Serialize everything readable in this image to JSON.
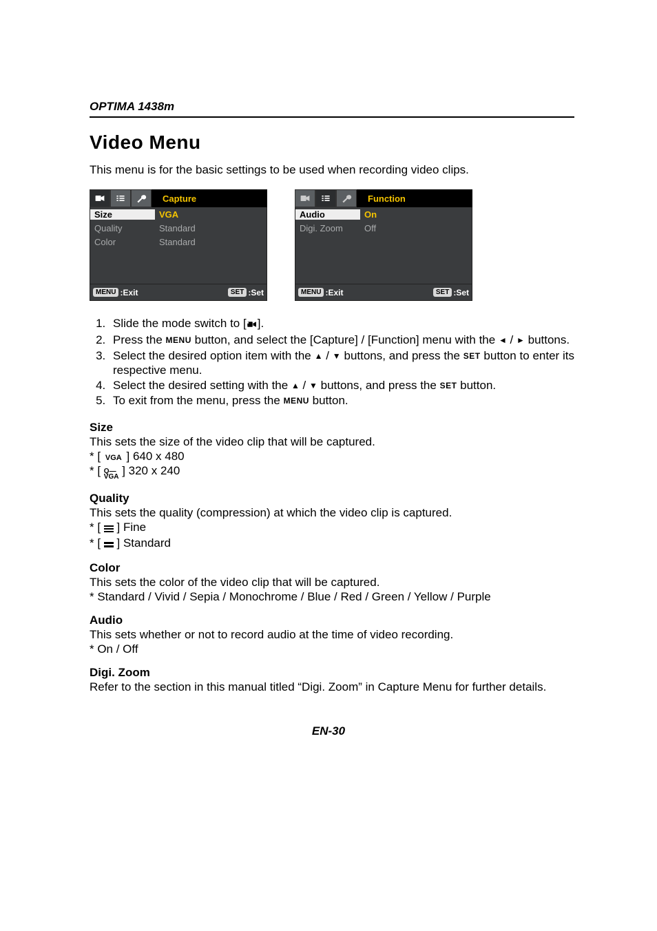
{
  "model": "OPTIMA 1438m",
  "title": "Video Menu",
  "intro": "This menu is for the basic settings to be used when recording video clips.",
  "shot_capture": {
    "header": "Capture",
    "rows": [
      {
        "k": "Size",
        "v": "VGA"
      },
      {
        "k": "Quality",
        "v": "Standard"
      },
      {
        "k": "Color",
        "v": "Standard"
      }
    ],
    "footer": {
      "menu": "MENU",
      "exit": ":Exit",
      "set": "SET",
      "setlbl": ":Set"
    }
  },
  "shot_function": {
    "header": "Function",
    "rows": [
      {
        "k": "Audio",
        "v": "On"
      },
      {
        "k": "Digi. Zoom",
        "v": "Off"
      }
    ],
    "footer": {
      "menu": "MENU",
      "exit": ":Exit",
      "set": "SET",
      "setlbl": ":Set"
    }
  },
  "steps": {
    "s1a": "Slide the mode switch to [",
    "s1b": "].",
    "s2a": "Press the ",
    "s2b": " button, and select the [Capture] / [Function] menu with the ",
    "s2c": " buttons.",
    "s3a": "Select the desired option item with the ",
    "s3b": " buttons, and press the ",
    "s3c": " button to enter its respective menu.",
    "s4a": "Select the desired setting with the ",
    "s4b": " buttons, and press the ",
    "s4c": " button.",
    "s5a": "To exit from the menu, press the ",
    "s5b": " button."
  },
  "labels": {
    "menu": "MENU",
    "set": "SET",
    "vga": "VGA",
    "qvga_top": "Q",
    "qvga_bot": "VGA"
  },
  "size": {
    "h": "Size",
    "desc": "This sets the size of the video clip that will be captured.",
    "v1": " ] 640 x 480",
    "v2": " ] 320 x 240"
  },
  "quality": {
    "h": "Quality",
    "desc": "This sets the quality (compression) at which the video clip is captured.",
    "v1": " ] Fine",
    "v2": " ] Standard"
  },
  "color": {
    "h": "Color",
    "desc": "This sets the color of the video clip that will be captured.",
    "opts": "* Standard / Vivid / Sepia / Monochrome / Blue / Red / Green / Yellow / Purple"
  },
  "audio": {
    "h": "Audio",
    "desc": "This sets whether or not to record audio at the time of video recording.",
    "opts": "*  On / Off"
  },
  "digizoom": {
    "h": "Digi. Zoom",
    "desc": "Refer to the section in this manual titled “Digi. Zoom” in Capture Menu for further details."
  },
  "pagenum": "EN-30"
}
